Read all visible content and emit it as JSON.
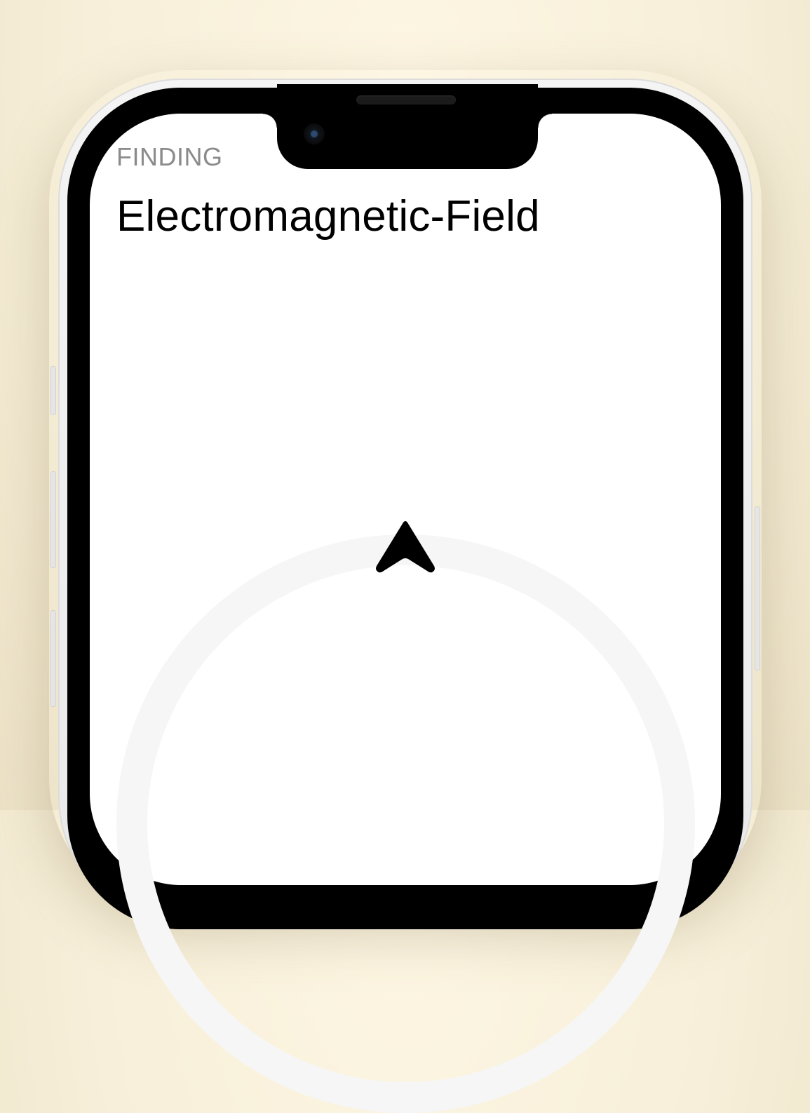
{
  "app": {
    "status_label": "FINDING",
    "target_name": "Electromagnetic-Field"
  },
  "compass": {
    "pointer_icon": "navigation-arrow-icon",
    "ring_color": "#f6f6f6"
  },
  "theme": {
    "background": "#fdf6e3",
    "screen": "#ffffff",
    "text_primary": "#000000",
    "text_secondary": "#8b8b8b"
  }
}
